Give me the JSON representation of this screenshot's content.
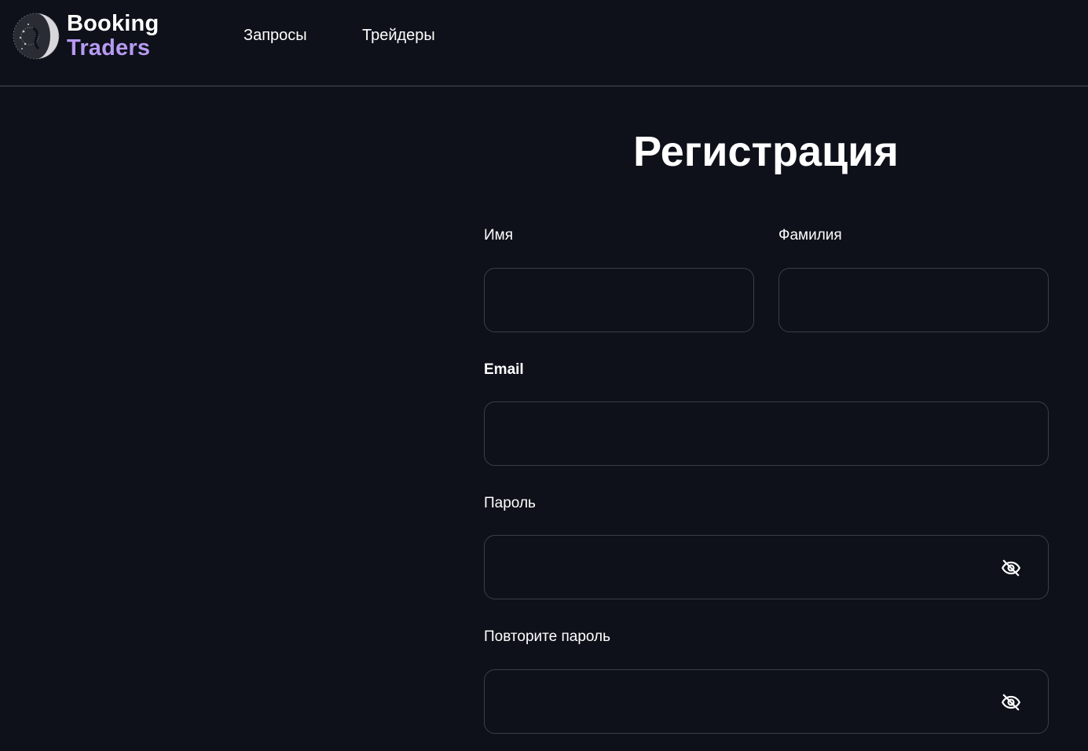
{
  "header": {
    "logo": {
      "line1": "Booking",
      "line2": "Traders"
    },
    "nav": [
      {
        "label": "Запросы"
      },
      {
        "label": "Трейдеры"
      }
    ]
  },
  "form": {
    "title": "Регистрация",
    "fields": {
      "first_name": {
        "label": "Имя",
        "value": ""
      },
      "last_name": {
        "label": "Фамилия",
        "value": ""
      },
      "email": {
        "label": "Email",
        "value": ""
      },
      "password": {
        "label": "Пароль",
        "value": "",
        "icon": "eye-off-icon"
      },
      "password_repeat": {
        "label": "Повторите пароль",
        "value": "",
        "icon": "eye-off-icon"
      }
    }
  },
  "colors": {
    "background": "#0e111a",
    "accent": "#b79af2",
    "field_border": "#3b3e47",
    "divider": "#4a4d55"
  }
}
